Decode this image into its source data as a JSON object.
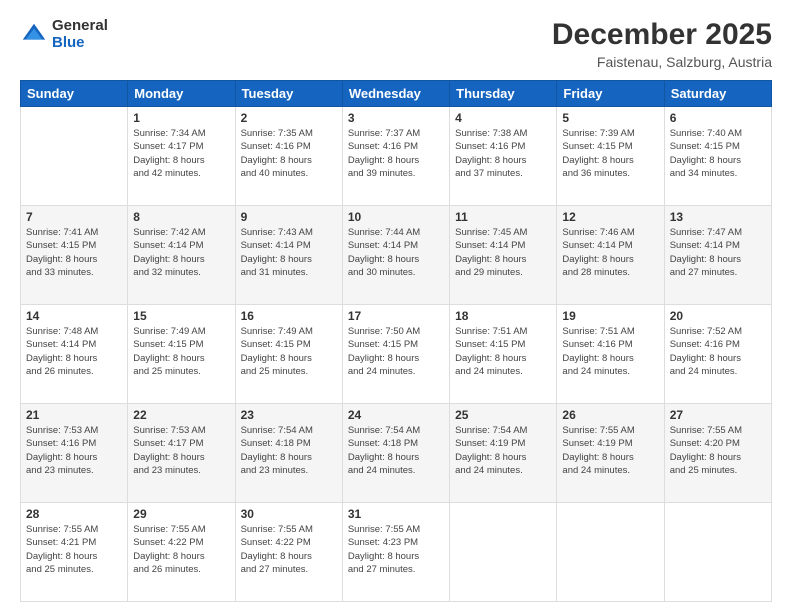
{
  "logo": {
    "general": "General",
    "blue": "Blue"
  },
  "header": {
    "month_year": "December 2025",
    "location": "Faistenau, Salzburg, Austria"
  },
  "days_of_week": [
    "Sunday",
    "Monday",
    "Tuesday",
    "Wednesday",
    "Thursday",
    "Friday",
    "Saturday"
  ],
  "weeks": [
    [
      {
        "day": "",
        "sunrise": "",
        "sunset": "",
        "daylight": ""
      },
      {
        "day": "1",
        "sunrise": "Sunrise: 7:34 AM",
        "sunset": "Sunset: 4:17 PM",
        "daylight": "Daylight: 8 hours and 42 minutes."
      },
      {
        "day": "2",
        "sunrise": "Sunrise: 7:35 AM",
        "sunset": "Sunset: 4:16 PM",
        "daylight": "Daylight: 8 hours and 40 minutes."
      },
      {
        "day": "3",
        "sunrise": "Sunrise: 7:37 AM",
        "sunset": "Sunset: 4:16 PM",
        "daylight": "Daylight: 8 hours and 39 minutes."
      },
      {
        "day": "4",
        "sunrise": "Sunrise: 7:38 AM",
        "sunset": "Sunset: 4:16 PM",
        "daylight": "Daylight: 8 hours and 37 minutes."
      },
      {
        "day": "5",
        "sunrise": "Sunrise: 7:39 AM",
        "sunset": "Sunset: 4:15 PM",
        "daylight": "Daylight: 8 hours and 36 minutes."
      },
      {
        "day": "6",
        "sunrise": "Sunrise: 7:40 AM",
        "sunset": "Sunset: 4:15 PM",
        "daylight": "Daylight: 8 hours and 34 minutes."
      }
    ],
    [
      {
        "day": "7",
        "sunrise": "Sunrise: 7:41 AM",
        "sunset": "Sunset: 4:15 PM",
        "daylight": "Daylight: 8 hours and 33 minutes."
      },
      {
        "day": "8",
        "sunrise": "Sunrise: 7:42 AM",
        "sunset": "Sunset: 4:14 PM",
        "daylight": "Daylight: 8 hours and 32 minutes."
      },
      {
        "day": "9",
        "sunrise": "Sunrise: 7:43 AM",
        "sunset": "Sunset: 4:14 PM",
        "daylight": "Daylight: 8 hours and 31 minutes."
      },
      {
        "day": "10",
        "sunrise": "Sunrise: 7:44 AM",
        "sunset": "Sunset: 4:14 PM",
        "daylight": "Daylight: 8 hours and 30 minutes."
      },
      {
        "day": "11",
        "sunrise": "Sunrise: 7:45 AM",
        "sunset": "Sunset: 4:14 PM",
        "daylight": "Daylight: 8 hours and 29 minutes."
      },
      {
        "day": "12",
        "sunrise": "Sunrise: 7:46 AM",
        "sunset": "Sunset: 4:14 PM",
        "daylight": "Daylight: 8 hours and 28 minutes."
      },
      {
        "day": "13",
        "sunrise": "Sunrise: 7:47 AM",
        "sunset": "Sunset: 4:14 PM",
        "daylight": "Daylight: 8 hours and 27 minutes."
      }
    ],
    [
      {
        "day": "14",
        "sunrise": "Sunrise: 7:48 AM",
        "sunset": "Sunset: 4:14 PM",
        "daylight": "Daylight: 8 hours and 26 minutes."
      },
      {
        "day": "15",
        "sunrise": "Sunrise: 7:49 AM",
        "sunset": "Sunset: 4:15 PM",
        "daylight": "Daylight: 8 hours and 25 minutes."
      },
      {
        "day": "16",
        "sunrise": "Sunrise: 7:49 AM",
        "sunset": "Sunset: 4:15 PM",
        "daylight": "Daylight: 8 hours and 25 minutes."
      },
      {
        "day": "17",
        "sunrise": "Sunrise: 7:50 AM",
        "sunset": "Sunset: 4:15 PM",
        "daylight": "Daylight: 8 hours and 24 minutes."
      },
      {
        "day": "18",
        "sunrise": "Sunrise: 7:51 AM",
        "sunset": "Sunset: 4:15 PM",
        "daylight": "Daylight: 8 hours and 24 minutes."
      },
      {
        "day": "19",
        "sunrise": "Sunrise: 7:51 AM",
        "sunset": "Sunset: 4:16 PM",
        "daylight": "Daylight: 8 hours and 24 minutes."
      },
      {
        "day": "20",
        "sunrise": "Sunrise: 7:52 AM",
        "sunset": "Sunset: 4:16 PM",
        "daylight": "Daylight: 8 hours and 24 minutes."
      }
    ],
    [
      {
        "day": "21",
        "sunrise": "Sunrise: 7:53 AM",
        "sunset": "Sunset: 4:16 PM",
        "daylight": "Daylight: 8 hours and 23 minutes."
      },
      {
        "day": "22",
        "sunrise": "Sunrise: 7:53 AM",
        "sunset": "Sunset: 4:17 PM",
        "daylight": "Daylight: 8 hours and 23 minutes."
      },
      {
        "day": "23",
        "sunrise": "Sunrise: 7:54 AM",
        "sunset": "Sunset: 4:18 PM",
        "daylight": "Daylight: 8 hours and 23 minutes."
      },
      {
        "day": "24",
        "sunrise": "Sunrise: 7:54 AM",
        "sunset": "Sunset: 4:18 PM",
        "daylight": "Daylight: 8 hours and 24 minutes."
      },
      {
        "day": "25",
        "sunrise": "Sunrise: 7:54 AM",
        "sunset": "Sunset: 4:19 PM",
        "daylight": "Daylight: 8 hours and 24 minutes."
      },
      {
        "day": "26",
        "sunrise": "Sunrise: 7:55 AM",
        "sunset": "Sunset: 4:19 PM",
        "daylight": "Daylight: 8 hours and 24 minutes."
      },
      {
        "day": "27",
        "sunrise": "Sunrise: 7:55 AM",
        "sunset": "Sunset: 4:20 PM",
        "daylight": "Daylight: 8 hours and 25 minutes."
      }
    ],
    [
      {
        "day": "28",
        "sunrise": "Sunrise: 7:55 AM",
        "sunset": "Sunset: 4:21 PM",
        "daylight": "Daylight: 8 hours and 25 minutes."
      },
      {
        "day": "29",
        "sunrise": "Sunrise: 7:55 AM",
        "sunset": "Sunset: 4:22 PM",
        "daylight": "Daylight: 8 hours and 26 minutes."
      },
      {
        "day": "30",
        "sunrise": "Sunrise: 7:55 AM",
        "sunset": "Sunset: 4:22 PM",
        "daylight": "Daylight: 8 hours and 27 minutes."
      },
      {
        "day": "31",
        "sunrise": "Sunrise: 7:55 AM",
        "sunset": "Sunset: 4:23 PM",
        "daylight": "Daylight: 8 hours and 27 minutes."
      },
      {
        "day": "",
        "sunrise": "",
        "sunset": "",
        "daylight": ""
      },
      {
        "day": "",
        "sunrise": "",
        "sunset": "",
        "daylight": ""
      },
      {
        "day": "",
        "sunrise": "",
        "sunset": "",
        "daylight": ""
      }
    ]
  ]
}
